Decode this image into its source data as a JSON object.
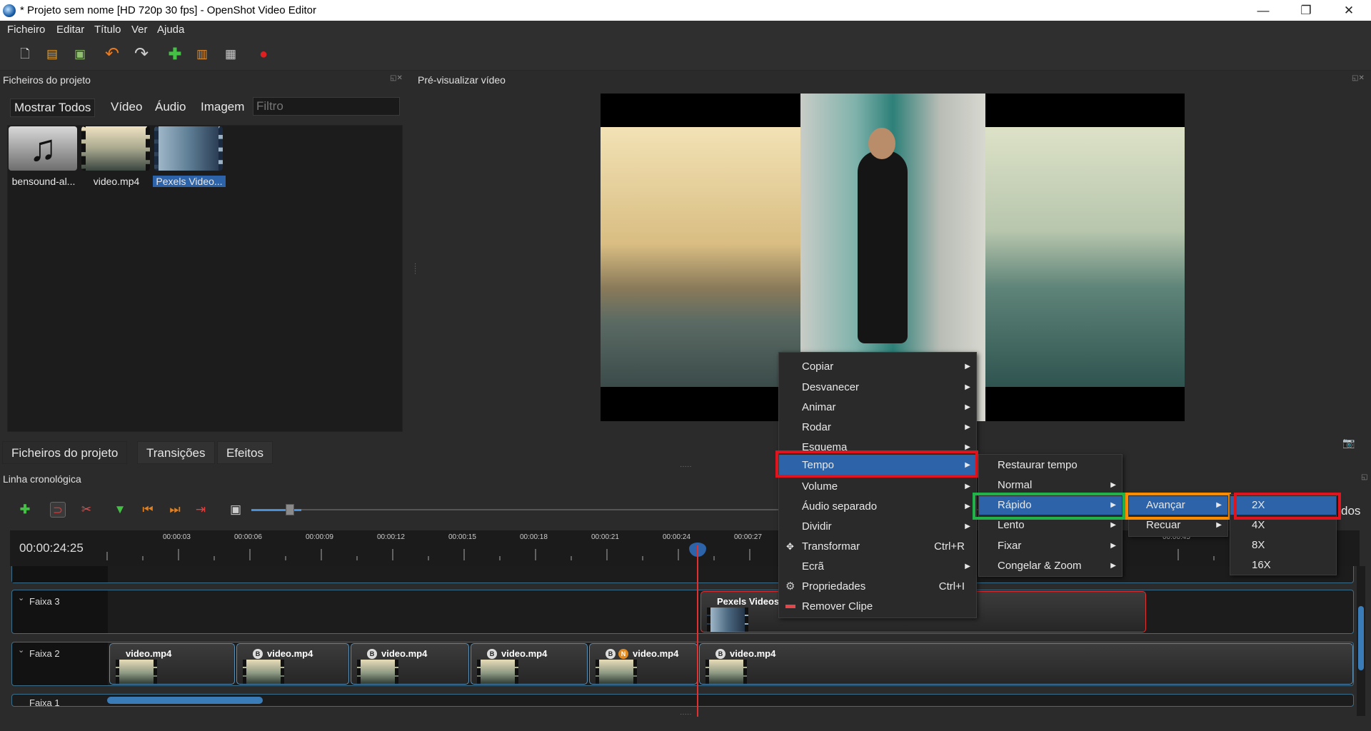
{
  "window": {
    "title": "* Projeto sem nome [HD 720p 30 fps] - OpenShot Video Editor",
    "controls": [
      "—",
      "❐",
      "✕"
    ]
  },
  "menubar": [
    "Ficheiro",
    "Editar",
    "Título",
    "Ver",
    "Ajuda"
  ],
  "panels": {
    "project_files_title": "Ficheiros do projeto",
    "preview_title": "Pré-visualizar vídeo",
    "timeline_title": "Linha cronológica"
  },
  "filter_tabs": [
    "Mostrar Todos",
    "Vídeo",
    "Áudio",
    "Imagem"
  ],
  "filter_placeholder": "Filtro",
  "files": [
    {
      "label": "bensound-al..."
    },
    {
      "label": "video.mp4"
    },
    {
      "label": "Pexels Video..."
    }
  ],
  "bottom_tabs": [
    "Ficheiros do projeto",
    "Transições",
    "Efeitos"
  ],
  "timeline": {
    "current_time": "00:00:24:25",
    "ticks": [
      "00:00:03",
      "00:00:06",
      "00:00:09",
      "00:00:12",
      "00:00:15",
      "00:00:18",
      "00:00:21",
      "00:00:24",
      "00:00:27",
      "00:00:45"
    ],
    "tracks": [
      {
        "name": "Faixa 3",
        "clips": [
          {
            "label": "Pexels Videos 2"
          }
        ]
      },
      {
        "name": "Faixa 2",
        "clips": [
          {
            "label": "video.mp4"
          },
          {
            "label": "video.mp4",
            "badge": "B"
          },
          {
            "label": "video.mp4",
            "badge": "B"
          },
          {
            "label": "video.mp4",
            "badge": "B"
          },
          {
            "label": "video.mp4",
            "badge": "B",
            "badge2": "N"
          },
          {
            "label": "video.mp4",
            "badge": "B"
          }
        ]
      },
      {
        "name": "Faixa 1"
      }
    ],
    "right_edge_text": "dos"
  },
  "context_menu": [
    {
      "label": "Copiar",
      "submenu": true
    },
    {
      "label": "Desvanecer",
      "submenu": true
    },
    {
      "label": "Animar",
      "submenu": true
    },
    {
      "label": "Rodar",
      "submenu": true
    },
    {
      "label": "Esquema",
      "submenu": true
    },
    {
      "label": "Tempo",
      "submenu": true
    },
    {
      "label": "Volume",
      "submenu": true
    },
    {
      "label": "Áudio separado",
      "submenu": true
    },
    {
      "label": "Dividir",
      "submenu": true
    },
    {
      "label": "Transformar",
      "shortcut": "Ctrl+R"
    },
    {
      "label": "Ecrã",
      "submenu": true
    },
    {
      "label": "Propriedades",
      "shortcut": "Ctrl+I"
    },
    {
      "label": "Remover Clipe"
    }
  ],
  "tempo_menu": [
    {
      "label": "Restaurar tempo"
    },
    {
      "label": "Normal",
      "submenu": true
    },
    {
      "label": "Rápido",
      "submenu": true
    },
    {
      "label": "Lento",
      "submenu": true
    },
    {
      "label": "Fixar",
      "submenu": true
    },
    {
      "label": "Congelar & Zoom",
      "submenu": true
    }
  ],
  "rapido_menu": [
    {
      "label": "Avançar",
      "submenu": true
    },
    {
      "label": "Recuar",
      "submenu": true
    }
  ],
  "speed_menu": [
    "2X",
    "4X",
    "8X",
    "16X"
  ],
  "colors": {
    "highlight_red": "#e0141e",
    "highlight_green": "#22b24a",
    "highlight_orange": "#ff8c00",
    "selection_blue": "#2d63a9"
  }
}
